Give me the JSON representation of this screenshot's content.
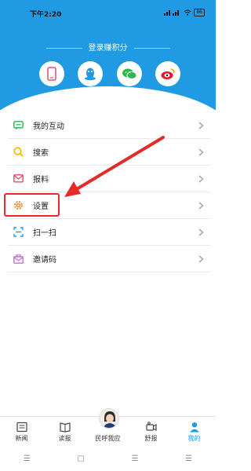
{
  "status": {
    "time": "下午2:20",
    "battery": "86"
  },
  "login": {
    "title": "登录赚积分"
  },
  "social": [
    {
      "icon": "phone-icon",
      "color": "#e94b6a"
    },
    {
      "icon": "qq-icon",
      "color": "#1f9ae3"
    },
    {
      "icon": "wechat-icon",
      "color": "#2ab94e"
    },
    {
      "icon": "weibo-icon",
      "color": "#e6162d"
    }
  ],
  "menu": [
    {
      "label": "我的互动",
      "icon": "chat-icon",
      "color": "#2ab94e"
    },
    {
      "label": "搜索",
      "icon": "search-icon",
      "color": "#f0b400"
    },
    {
      "label": "报料",
      "icon": "mail-icon",
      "color": "#e94b6a"
    },
    {
      "label": "设置",
      "icon": "gear-icon",
      "color": "#f08a1c"
    },
    {
      "label": "扫一扫",
      "icon": "scan-icon",
      "color": "#1f9ae3"
    },
    {
      "label": "邀请码",
      "icon": "invite-icon",
      "color": "#c86ad6"
    }
  ],
  "nav": [
    {
      "label": "新闻",
      "icon": "news-icon"
    },
    {
      "label": "读报",
      "icon": "newspaper-icon"
    },
    {
      "label": "民呼我应",
      "icon": "avatar-icon"
    },
    {
      "label": "舒报",
      "icon": "video-icon"
    },
    {
      "label": "我的",
      "icon": "user-icon",
      "active": true
    }
  ],
  "colors": {
    "brand": "#1f9ae3",
    "highlight": "#e52a2a"
  }
}
